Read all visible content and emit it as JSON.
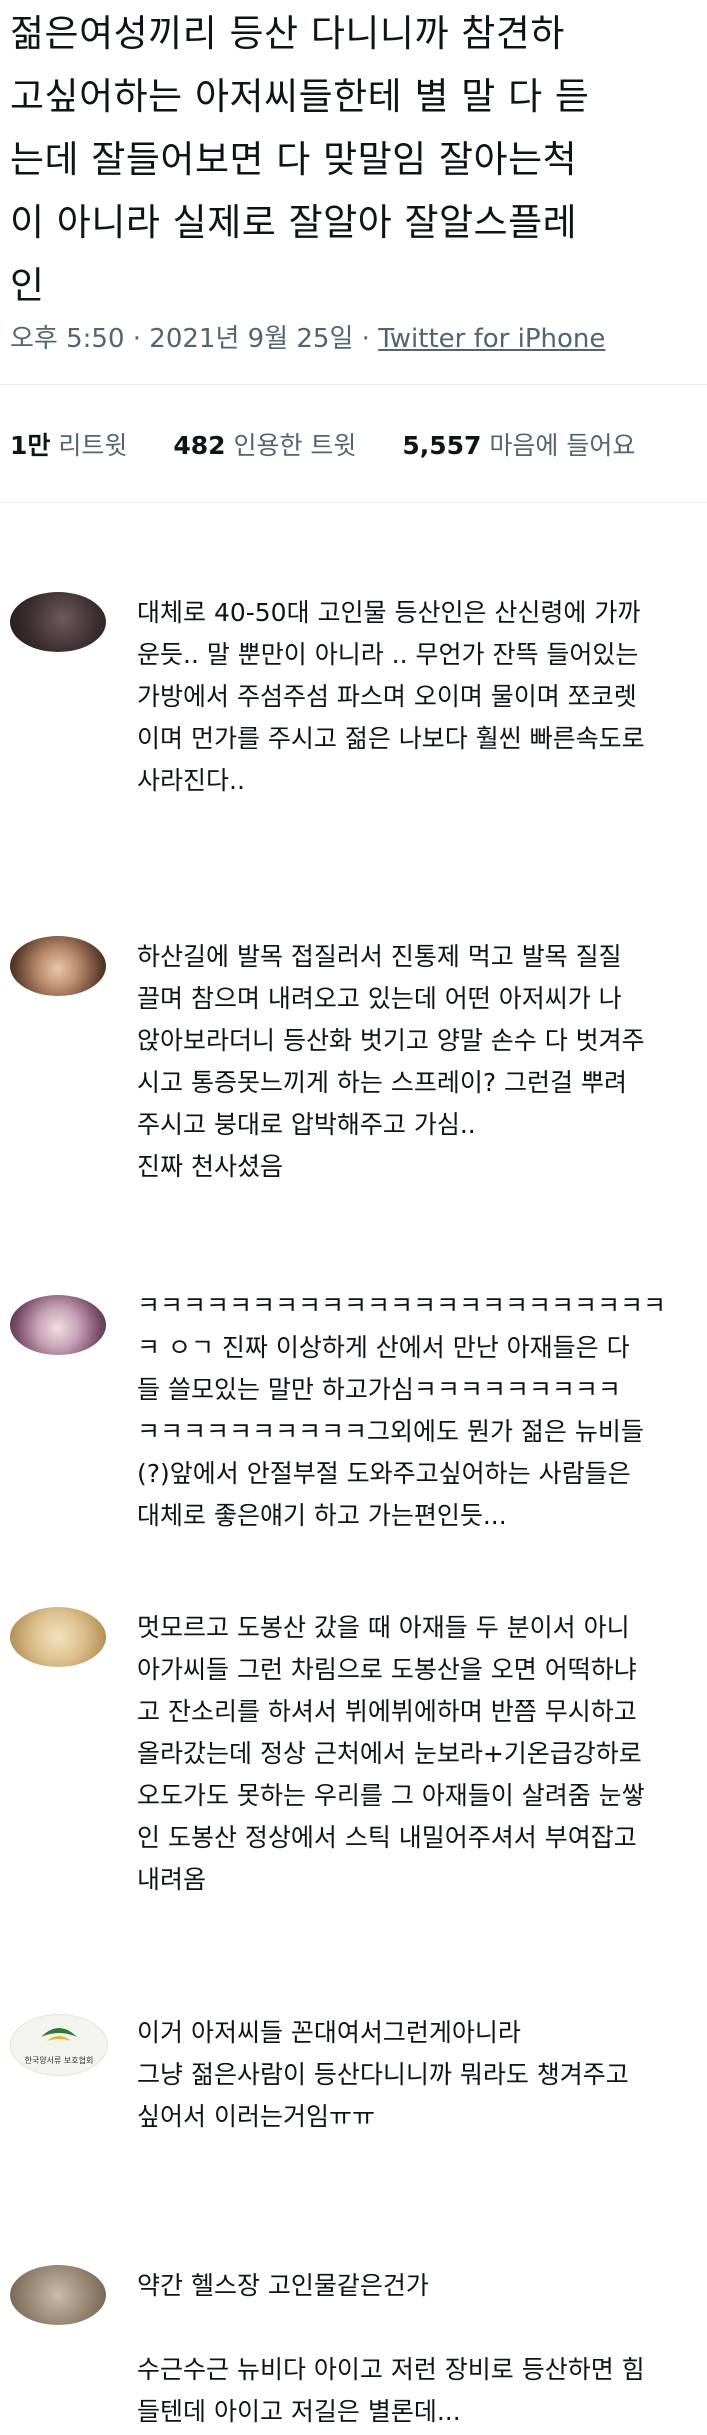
{
  "tweet": {
    "text": "젊은여성끼리 등산 다니니까 참견하\n고싶어하는 아저씨들한테 별 말 다 듣\n는데 잘들어보면 다 맞말임 잘아는척\n이 아니라 실제로 잘알아 잘알스플레\n인",
    "time": "오후 5:50",
    "date": "2021년 9월 25일",
    "separator": "·",
    "source": "Twitter for iPhone"
  },
  "stats": {
    "retweets_count": "1만",
    "retweets_label": "리트윗",
    "quotes_count": "482",
    "quotes_label": "인용한 트윗",
    "likes_count": "5,557",
    "likes_label": "마음에 들어요"
  },
  "replies": [
    {
      "text": "대체로 40-50대 고인물 등산인은 산신령에 가까\n운듯.. 말 뿐만이 아니라 .. 무언가 잔뜩 들어있는\n가방에서 주섬주섬 파스며 오이며 물이며 쪼코렛\n이며 먼가를 주시고 젊은 나보다 훨씬 빠른속도로\n사라진다..",
      "avatar_color": "#3b2e30"
    },
    {
      "text": "하산길에 발목 접질러서 진통제 먹고 발목 질질\n끌며 참으며 내려오고 있는데 어떤 아저씨가 나\n앉아보라더니 등산화 벗기고 양말 손수 다 벗겨주\n시고 통증못느끼게 하는 스프레이? 그런걸 뿌려\n주시고 붕대로 압박해주고 가심..\n진짜 천사셨음",
      "avatar_color": "#6b4a3a"
    },
    {
      "text": "ㅋㅋㅋㅋㅋㅋㅋㅋㅋㅋㅋㅋㅋㅋㅋㅋㅋㅋㅋㅋㅋㅋㅋ\nㅋ ㅇㄱ 진짜 이상하게 산에서 만난 아재들은 다\n들 쓸모있는 말만 하고가심ㅋㅋㅋㅋㅋㅋㅋㅋㅋ\nㅋㅋㅋㅋㅋㅋㅋㅋㅋㅋ그외에도 뭔가 젊은 뉴비들\n(?)앞에서 안절부절 도와주고싶어하는 사람들은\n대체로 좋은얘기 하고 가는편인듯...",
      "avatar_color": "#8a6a7c"
    },
    {
      "text": "멋모르고 도봉산 갔을 때 아재들 두 분이서 아니\n아가씨들 그런 차림으로 도봉산을 오면 어떡하냐\n고 잔소리를 하셔서 뷔에뷔에하며 반쯤 무시하고\n올라갔는데 정상 근처에서 눈보라+기온급강하로\n오도가도 못하는 우리를 그 아재들이 살려줌 눈쌓\n인 도봉산 정상에서 스틱 내밀어주셔서 부여잡고\n내려옴",
      "avatar_color": "#d8bf8e"
    },
    {
      "text": "이거 아저씨들 꼰대여서그런게아니라\n그냥 젊은사람이 등산다니니까 뭐라도 챙겨주고\n싶어서 이러는거임ㅠㅠ",
      "avatar_color": "#f2f2ea",
      "avatar_logo_text": "한국양서류 보호협회"
    },
    {
      "text": "약간 헬스장 고인물같은건가\n\n수근수근 뉴비다 아이고 저런 장비로 등산하면 힘\n들텐데 아이고 저길은 별론데...",
      "avatar_color": "#9a8a76"
    }
  ]
}
